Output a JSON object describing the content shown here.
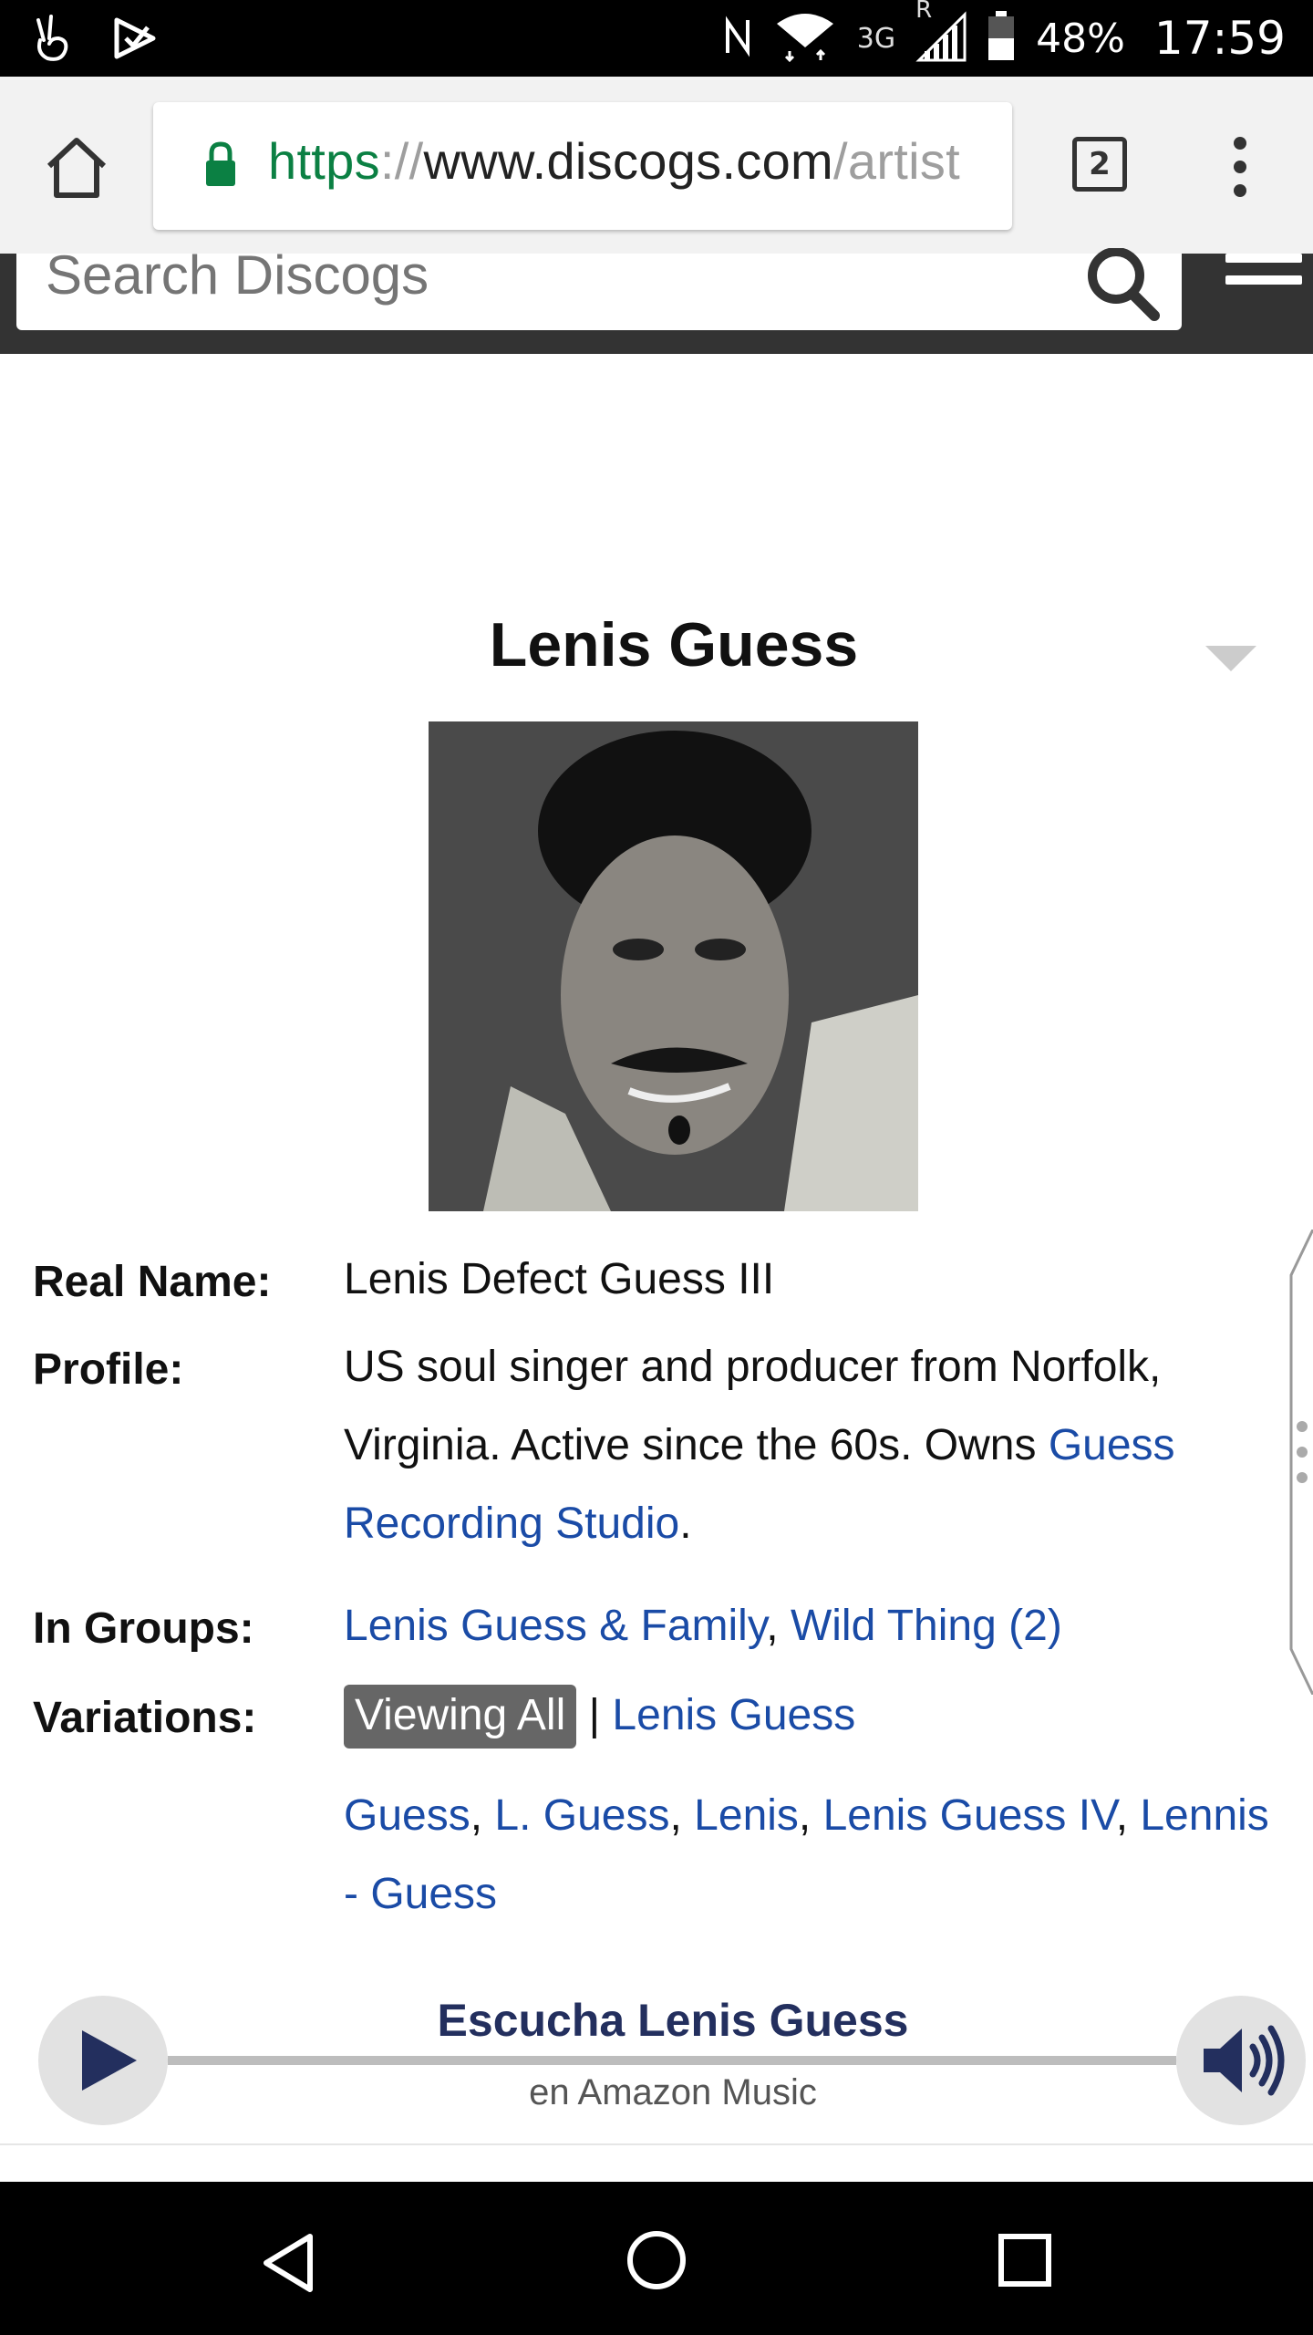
{
  "status_bar": {
    "network": "3G",
    "roaming": "R",
    "battery": "48%",
    "time": "17:59"
  },
  "browser": {
    "url_scheme": "https",
    "url_sep": "://",
    "url_host": "www.discogs.com",
    "url_path": "/artist",
    "tab_count": "2"
  },
  "site": {
    "search_placeholder": "Search Discogs"
  },
  "artist": {
    "name": "Lenis Guess",
    "photo_alt": "Lenis Guess",
    "real_name_label": "Real Name:",
    "real_name": "Lenis Defect Guess III",
    "profile_label": "Profile:",
    "profile_text": "US soul singer and producer from Norfolk, Virginia. Active since the 60s. Owns ",
    "profile_link": "Guess Recording Studio",
    "profile_end": ".",
    "groups_label": "In Groups:",
    "groups": [
      "Lenis Guess & Family",
      "Wild Thing (2)"
    ],
    "variations_label": "Variations:",
    "variations_active": "Viewing All",
    "variations_divider": "|",
    "variations_primary": "Lenis Guess",
    "variations": [
      "Guess",
      "L. Guess",
      "Lenis",
      "Lenis Guess IV",
      "Lennis -",
      "Guess"
    ]
  },
  "player": {
    "title": "Escucha Lenis Guess",
    "subtitle": "en Amazon Music"
  }
}
